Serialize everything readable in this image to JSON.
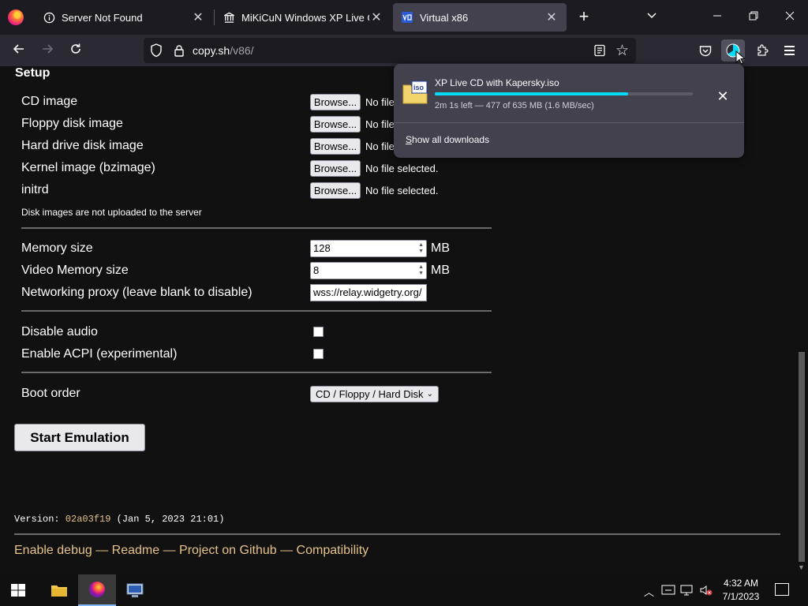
{
  "browser": {
    "tabs": [
      {
        "title": "Server Not Found",
        "icon": "info-circle-icon",
        "active": false
      },
      {
        "title": "MiKiCuN Windows XP Live CD",
        "icon": "library-icon",
        "active": false
      },
      {
        "title": "Virtual x86",
        "icon": "v86-icon",
        "active": true
      }
    ],
    "url_host": "copy.sh",
    "url_path": "/v86/"
  },
  "download": {
    "filename": "XP Live CD with Kapersky.iso",
    "status": "2m 1s left — 477 of 635 MB (1.6 MB/sec)",
    "progress": 0.75,
    "show_all_label_underlined": "S",
    "show_all_label_rest": "how all downloads"
  },
  "setup": {
    "title": "Setup",
    "file_inputs": [
      {
        "label": "CD image",
        "button": "Browse...",
        "status": "No file selected."
      },
      {
        "label": "Floppy disk image",
        "button": "Browse...",
        "status": "No file selected."
      },
      {
        "label": "Hard drive disk image",
        "button": "Browse...",
        "status": "No file selected."
      },
      {
        "label": "Kernel image (bzimage)",
        "button": "Browse...",
        "status": "No file selected."
      },
      {
        "label": "initrd",
        "button": "Browse...",
        "status": "No file selected."
      }
    ],
    "file_inputs_partial_status": "No file",
    "note": "Disk images are not uploaded to the server",
    "memory_label": "Memory size",
    "memory_value": "128",
    "memory_unit": "MB",
    "vga_label": "Video Memory size",
    "vga_value": "8",
    "vga_unit": "MB",
    "proxy_label": "Networking proxy (leave blank to disable)",
    "proxy_value": "wss://relay.widgetry.org/",
    "disable_audio_label": "Disable audio",
    "acpi_label": "Enable ACPI (experimental)",
    "boot_order_label": "Boot order",
    "boot_order_value": "CD / Floppy / Hard Disk",
    "start_button": "Start Emulation"
  },
  "version": {
    "prefix": "Version: ",
    "hash": "02a03f19",
    "date": " (Jan 5, 2023 21:01)"
  },
  "footer_links": [
    "Enable debug",
    "Readme",
    "Project on Github",
    "Compatibility"
  ],
  "footer_separator": " — ",
  "taskbar": {
    "time": "4:32 AM",
    "date": "7/1/2023"
  },
  "colors": {
    "accent_progress": "#00ddff",
    "link": "#e6c28a",
    "page_bg": "#111111"
  }
}
